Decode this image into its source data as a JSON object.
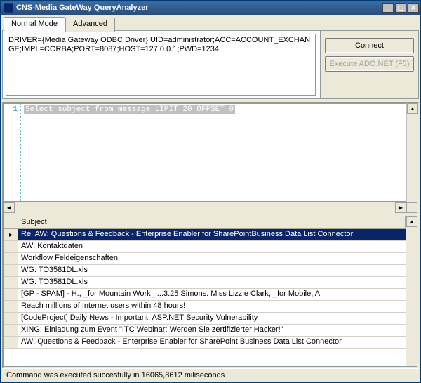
{
  "window": {
    "title": "CNS-Media GateWay QueryAnalyzer"
  },
  "tabs": {
    "normal": "Normal Mode",
    "advanced": "Advanced"
  },
  "conn_string": "DRIVER={Media Gateway ODBC Driver};UID=administrator;ACC=ACCOUNT_EXCHANGE;IMPL=CORBA;PORT=8087;HOST=127.0.0.1;PWD=1234;",
  "buttons": {
    "connect": "Connect",
    "execute": "Execute ADO.NET (F5)"
  },
  "sql": {
    "line_no": "1",
    "text": "Select subject from message LIMIT 20 OFFSET 0"
  },
  "grid": {
    "header": "Subject",
    "rows": [
      "Re: AW: Questions & Feedback - Enterprise Enabler for SharePointBusiness Data List Connector",
      "AW: Kontaktdaten",
      "Workflow Feldeigenschaften",
      "WG: TO3581DL.xls",
      "WG: TO3581DL.xls",
      "[GP - SPAM] - H., _for Mountain Work_ ...3.25 Simons. Miss Lizzie Clark, _for Mobile, A",
      "Reach millions of Internet users within 48 hours!",
      "[CodeProject] Daily News - Important: ASP.NET Security Vulnerability",
      "XING: Einladung zum Event \"ITC Webinar: Werden Sie zertifizierter Hacker!\"",
      "AW: Questions & Feedback - Enterprise Enabler for SharePoint Business Data List Connector"
    ],
    "selected_index": 0
  },
  "status": "Command was executed succesfully in 16065,8612 miliseconds"
}
